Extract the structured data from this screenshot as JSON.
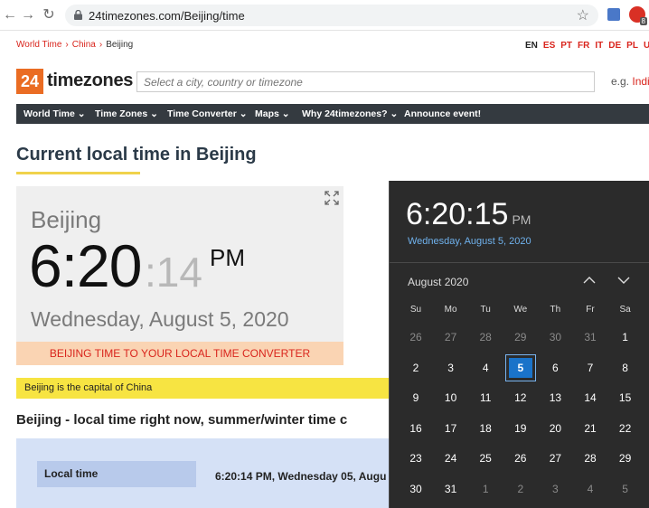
{
  "browser": {
    "url": "24timezones.com/Beijing/time",
    "extension_badge": "8"
  },
  "breadcrumb": {
    "items": [
      "World Time",
      "China",
      "Beijing"
    ],
    "separator": "›"
  },
  "languages": [
    "EN",
    "ES",
    "PT",
    "FR",
    "IT",
    "DE",
    "PL",
    "UK"
  ],
  "header": {
    "logo_num": "24",
    "logo_text": "timezones",
    "search_placeholder": "Select a city, country or timezone",
    "eg_label": "e.g.",
    "eg_link": "India"
  },
  "nav": [
    "World Time",
    "Time Zones",
    "Time Converter",
    "Maps",
    "Why 24timezones?",
    "Announce event!"
  ],
  "page": {
    "title": "Current local time in Beijing",
    "clock": {
      "city": "Beijing",
      "hm": "6:20",
      "sec": ":14",
      "ampm": "PM",
      "date": "Wednesday, August 5, 2020"
    },
    "converter_label": "BEIJING TIME TO YOUR LOCAL TIME CONVERTER",
    "capital_note": "Beijing is the capital of China",
    "subheading": "Beijing - local time right now, summer/winter time c",
    "info_label": "Local time",
    "info_value": "6:20:14 PM, Wednesday 05, Augu"
  },
  "flyout": {
    "time": "6:20:15",
    "ampm": "PM",
    "date": "Wednesday, August 5, 2020",
    "month": "August 2020",
    "weekdays": [
      "Su",
      "Mo",
      "Tu",
      "We",
      "Th",
      "Fr",
      "Sa"
    ],
    "weeks": [
      [
        "26",
        "27",
        "28",
        "29",
        "30",
        "31",
        "1"
      ],
      [
        "2",
        "3",
        "4",
        "5",
        "6",
        "7",
        "8"
      ],
      [
        "9",
        "10",
        "11",
        "12",
        "13",
        "14",
        "15"
      ],
      [
        "16",
        "17",
        "18",
        "19",
        "20",
        "21",
        "22"
      ],
      [
        "23",
        "24",
        "25",
        "26",
        "27",
        "28",
        "29"
      ],
      [
        "30",
        "31",
        "1",
        "2",
        "3",
        "4",
        "5"
      ]
    ],
    "selected_day": "5",
    "colors": {
      "background": "#2b2b2b",
      "accent": "#1a73c9",
      "date_text": "#6fb1ec"
    }
  },
  "colors": {
    "link_red": "#d9251d",
    "logo_orange": "#ea6c23",
    "nav_dark": "#343a40",
    "highlight_yellow": "#f7e442",
    "info_blue": "#d5e1f6"
  }
}
